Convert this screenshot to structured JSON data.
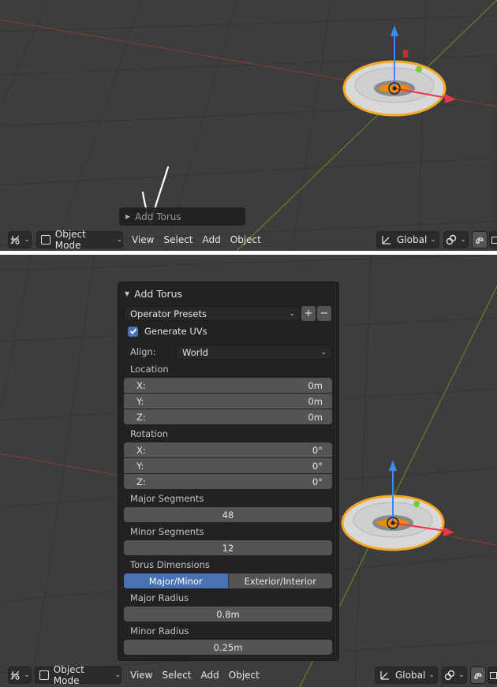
{
  "header": {
    "mode": "Object Mode",
    "menus": [
      "View",
      "Select",
      "Add",
      "Object"
    ],
    "orientation": "Global"
  },
  "collapsed_panel": {
    "title": "Add Torus"
  },
  "panel": {
    "title": "Add Torus",
    "presets_label": "Operator Presets",
    "preset_add": "+",
    "preset_remove": "−",
    "generate_uvs": {
      "label": "Generate UVs",
      "checked": true
    },
    "align": {
      "label": "Align:",
      "value": "World"
    },
    "location": {
      "label": "Location",
      "x_label": "X:",
      "x": "0m",
      "y_label": "Y:",
      "y": "0m",
      "z_label": "Z:",
      "z": "0m"
    },
    "rotation": {
      "label": "Rotation",
      "x_label": "X:",
      "x": "0°",
      "y_label": "Y:",
      "y": "0°",
      "z_label": "Z:",
      "z": "0°"
    },
    "major_segments": {
      "label": "Major Segments",
      "value": "48"
    },
    "minor_segments": {
      "label": "Minor Segments",
      "value": "12"
    },
    "torus_dimensions": {
      "label": "Torus Dimensions",
      "option_a": "Major/Minor",
      "option_b": "Exterior/Interior",
      "selected": "Major/Minor"
    },
    "major_radius": {
      "label": "Major Radius",
      "value": "0.8m"
    },
    "minor_radius": {
      "label": "Minor Radius",
      "value": "0.25m"
    }
  },
  "colors": {
    "accent": "#4772b3",
    "viewport": "#3d3d3d",
    "panel": "#222222",
    "field": "#545454",
    "selection": "#f5a623"
  }
}
